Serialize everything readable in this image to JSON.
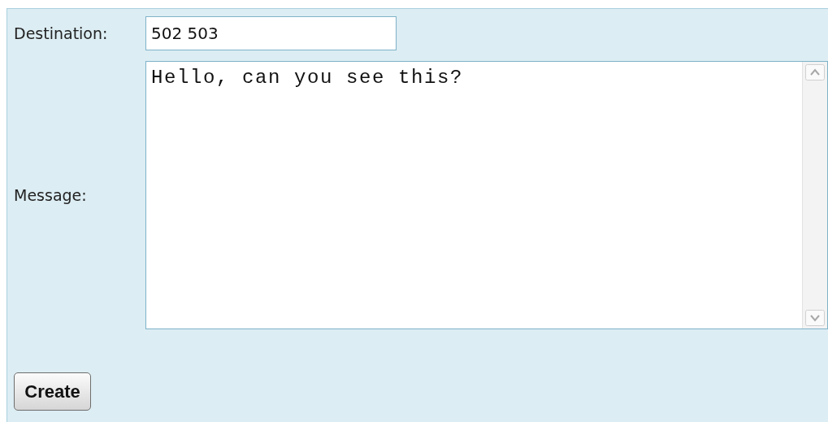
{
  "destination": {
    "label": "Destination:",
    "value": "502 503"
  },
  "message": {
    "label": "Message:",
    "value": "Hello, can you see this?"
  },
  "buttons": [
    {
      "label": "Create"
    }
  ]
}
